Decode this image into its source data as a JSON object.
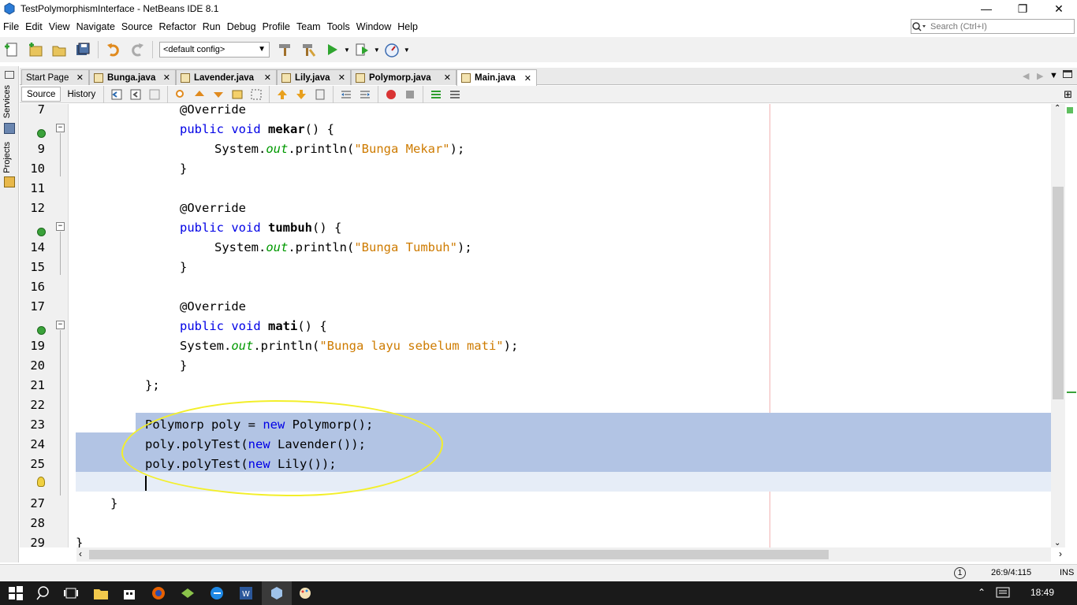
{
  "window": {
    "title": "TestPolymorphismInterface - NetBeans IDE 8.1"
  },
  "menu": [
    "File",
    "Edit",
    "View",
    "Navigate",
    "Source",
    "Refactor",
    "Run",
    "Debug",
    "Profile",
    "Team",
    "Tools",
    "Window",
    "Help"
  ],
  "search": {
    "placeholder": "Search (Ctrl+I)"
  },
  "toolbar": {
    "config_value": "<default config>"
  },
  "sidebar": {
    "services_label": "Services",
    "projects_label": "Projects"
  },
  "tabs": [
    {
      "label": "Start Page"
    },
    {
      "label": "Bunga.java"
    },
    {
      "label": "Lavender.java"
    },
    {
      "label": "Lily.java"
    },
    {
      "label": "Polymorp.java"
    },
    {
      "label": "Main.java"
    }
  ],
  "editor_view": {
    "source": "Source",
    "history": "History"
  },
  "code_lines": [
    {
      "n": "7",
      "text": "@Override"
    },
    {
      "n": "",
      "text": "public void mekar() {"
    },
    {
      "n": "9",
      "text": "System.out.println(\"Bunga Mekar\");"
    },
    {
      "n": "10",
      "text": "}"
    },
    {
      "n": "11",
      "text": ""
    },
    {
      "n": "12",
      "text": "@Override"
    },
    {
      "n": "",
      "text": "public void tumbuh() {"
    },
    {
      "n": "14",
      "text": "System.out.println(\"Bunga Tumbuh\");"
    },
    {
      "n": "15",
      "text": "}"
    },
    {
      "n": "16",
      "text": ""
    },
    {
      "n": "17",
      "text": "@Override"
    },
    {
      "n": "",
      "text": "public void mati() {"
    },
    {
      "n": "19",
      "text": "System.out.println(\"Bunga layu sebelum mati\");"
    },
    {
      "n": "20",
      "text": "}"
    },
    {
      "n": "21",
      "text": "};"
    },
    {
      "n": "22",
      "text": ""
    },
    {
      "n": "23",
      "text": "Polymorp poly = new Polymorp();"
    },
    {
      "n": "24",
      "text": "poly.polyTest(new Lavender());"
    },
    {
      "n": "25",
      "text": "poly.polyTest(new Lily());"
    },
    {
      "n": "",
      "text": ""
    },
    {
      "n": "27",
      "text": "}"
    },
    {
      "n": "28",
      "text": ""
    },
    {
      "n": "29",
      "text": "}"
    }
  ],
  "status": {
    "position": "26:9/4:115",
    "mode": "INS",
    "notifications": "1"
  },
  "taskbar": {
    "clock": "18:49"
  },
  "colors": {
    "keyword": "#0000e6",
    "string": "#ce7b00",
    "field": "#009900",
    "selection": "#b2c4e4",
    "annotation_ring": "#f3ef2a"
  }
}
